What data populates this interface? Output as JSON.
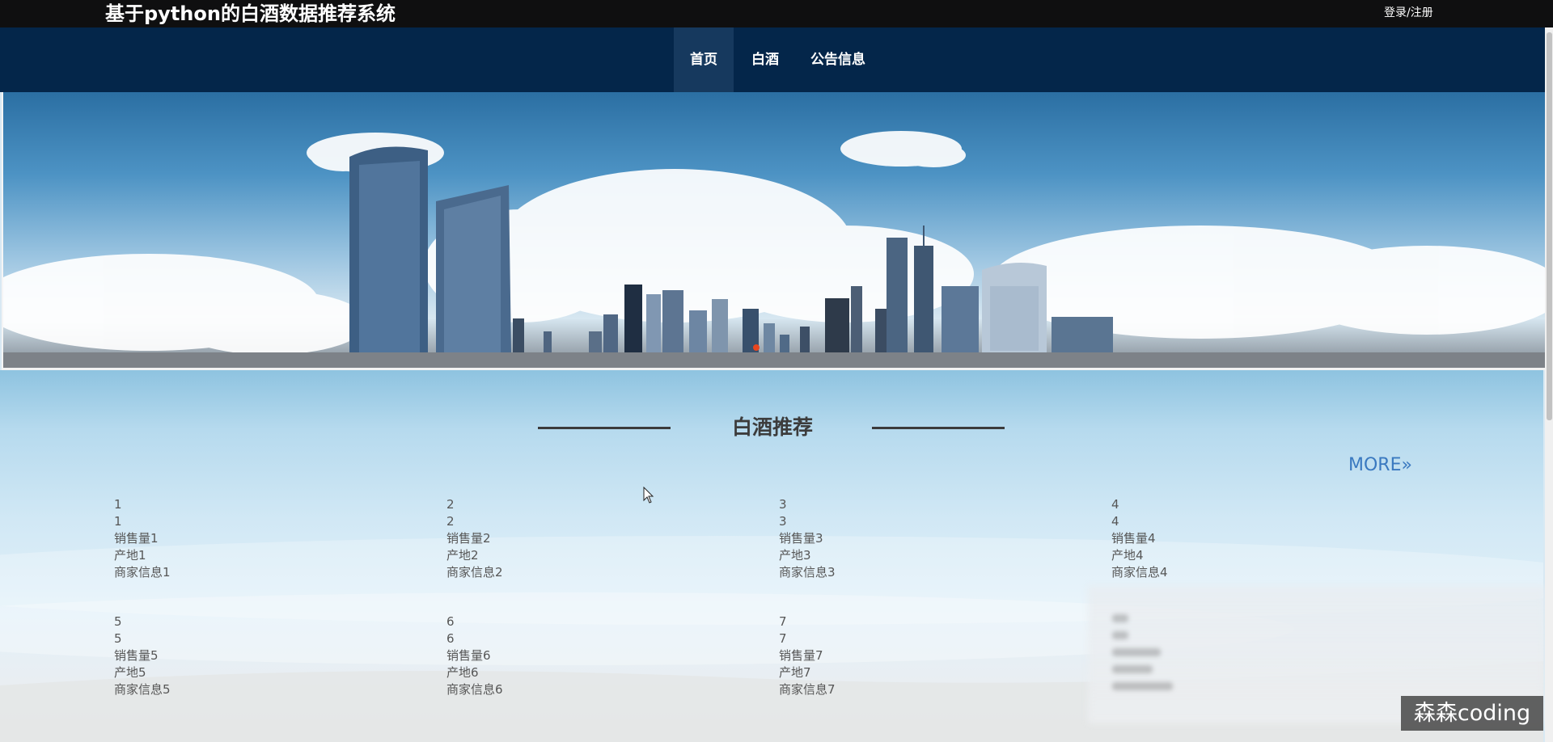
{
  "header": {
    "site_title": "基于python的白酒数据推荐系统",
    "login_register": "登录/注册"
  },
  "nav": {
    "items": [
      {
        "label": "首页",
        "active": true
      },
      {
        "label": "白酒",
        "active": false
      },
      {
        "label": "公告信息",
        "active": false
      }
    ]
  },
  "banner": {
    "slide_count": 1,
    "active_slide": 1,
    "indicator_color": "#e8451e"
  },
  "section": {
    "title": "白酒推荐",
    "more_label": "MORE",
    "more_icon": "double-chevron-right-icon",
    "products": [
      {
        "name": "1",
        "line2": "1",
        "sales": "销售量1",
        "origin": "产地1",
        "merchant": "商家信息1"
      },
      {
        "name": "2",
        "line2": "2",
        "sales": "销售量2",
        "origin": "产地2",
        "merchant": "商家信息2"
      },
      {
        "name": "3",
        "line2": "3",
        "sales": "销售量3",
        "origin": "产地3",
        "merchant": "商家信息3"
      },
      {
        "name": "4",
        "line2": "4",
        "sales": "销售量4",
        "origin": "产地4",
        "merchant": "商家信息4"
      },
      {
        "name": "5",
        "line2": "5",
        "sales": "销售量5",
        "origin": "产地5",
        "merchant": "商家信息5"
      },
      {
        "name": "6",
        "line2": "6",
        "sales": "销售量6",
        "origin": "产地6",
        "merchant": "商家信息6"
      },
      {
        "name": "7",
        "line2": "7",
        "sales": "销售量7",
        "origin": "产地7",
        "merchant": "商家信息7"
      }
    ]
  },
  "watermark": "森森coding",
  "colors": {
    "topbar": "#0f0f10",
    "navbar": "#04264a",
    "nav_active": "#16395e",
    "more_link": "#3a79c0"
  }
}
